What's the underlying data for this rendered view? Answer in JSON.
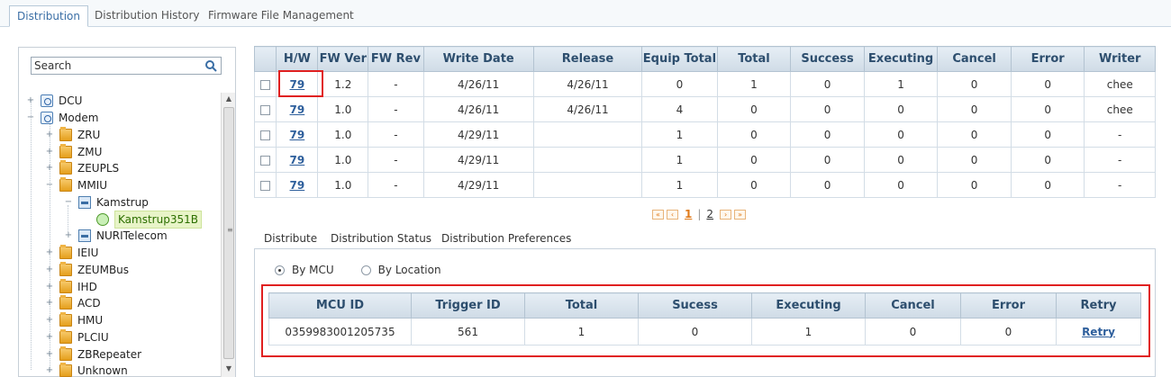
{
  "top_tabs": [
    "Distribution",
    "Distribution History",
    "Firmware File Management"
  ],
  "search": {
    "placeholder": "Search"
  },
  "tree": [
    {
      "label": "DCU",
      "icon": "globe-icon"
    },
    {
      "label": "Modem",
      "icon": "globe-icon"
    },
    {
      "label": "ZRU",
      "icon": "folder-icon"
    },
    {
      "label": "ZMU",
      "icon": "folder-icon"
    },
    {
      "label": "ZEUPLS",
      "icon": "folder-icon"
    },
    {
      "label": "MMIU",
      "icon": "folder-icon"
    },
    {
      "label": "Kamstrup",
      "icon": "document-icon"
    },
    {
      "label": "Kamstrup351B",
      "icon": "gear-icon",
      "selected": true
    },
    {
      "label": "NURITelecom",
      "icon": "document-icon"
    },
    {
      "label": "IEIU",
      "icon": "folder-icon"
    },
    {
      "label": "ZEUMBus",
      "icon": "folder-icon"
    },
    {
      "label": "IHD",
      "icon": "folder-icon"
    },
    {
      "label": "ACD",
      "icon": "folder-icon"
    },
    {
      "label": "HMU",
      "icon": "folder-icon"
    },
    {
      "label": "PLCIU",
      "icon": "folder-icon"
    },
    {
      "label": "ZBRepeater",
      "icon": "folder-icon"
    },
    {
      "label": "Unknown",
      "icon": "folder-icon"
    }
  ],
  "firmware_table": {
    "columns": [
      "H/W",
      "FW Ver",
      "FW Rev",
      "Write Date",
      "Release",
      "Equip Total",
      "Total",
      "Success",
      "Executing",
      "Cancel",
      "Error",
      "Writer"
    ],
    "rows": [
      [
        "79",
        "1.2",
        "-",
        "4/26/11",
        "4/26/11",
        "0",
        "1",
        "0",
        "1",
        "0",
        "0",
        "chee"
      ],
      [
        "79",
        "1.0",
        "-",
        "4/26/11",
        "4/26/11",
        "4",
        "0",
        "0",
        "0",
        "0",
        "0",
        "chee"
      ],
      [
        "79",
        "1.0",
        "-",
        "4/29/11",
        "",
        "1",
        "0",
        "0",
        "0",
        "0",
        "0",
        "-"
      ],
      [
        "79",
        "1.0",
        "-",
        "4/29/11",
        "",
        "1",
        "0",
        "0",
        "0",
        "0",
        "0",
        "-"
      ],
      [
        "79",
        "1.0",
        "-",
        "4/29/11",
        "",
        "1",
        "0",
        "0",
        "0",
        "0",
        "0",
        "-"
      ]
    ]
  },
  "pagination": {
    "pages": [
      "1",
      "2"
    ],
    "current": "1",
    "separator": "|"
  },
  "sub_tabs": [
    "Distribute",
    "Distribution Status",
    "Distribution Preferences"
  ],
  "radio_options": [
    "By MCU",
    "By Location"
  ],
  "mcu_table": {
    "columns": [
      "MCU ID",
      "Trigger ID",
      "Total",
      "Sucess",
      "Executing",
      "Cancel",
      "Error",
      "Retry"
    ],
    "rows": [
      [
        "0359983001205735",
        "561",
        "1",
        "0",
        "1",
        "0",
        "0",
        "Retry"
      ]
    ]
  },
  "colors": {
    "highlight": "#e02020",
    "link": "#2e5f9c",
    "pager": "#e07a1a",
    "selected_node": "#e8f4c8"
  }
}
